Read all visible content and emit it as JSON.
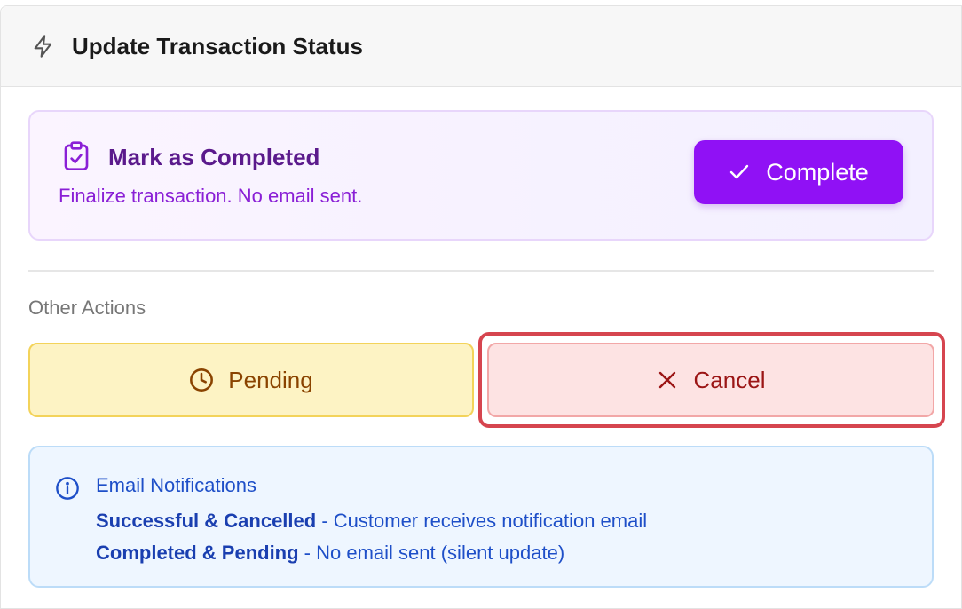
{
  "header": {
    "title": "Update Transaction Status",
    "icon": "bolt-icon"
  },
  "complete_box": {
    "title": "Mark as Completed",
    "description": "Finalize transaction. No email sent.",
    "button_label": "Complete",
    "icon": "clipboard-check-icon"
  },
  "other_actions": {
    "label": "Other Actions",
    "pending_label": "Pending",
    "cancel_label": "Cancel"
  },
  "info": {
    "title": "Email Notifications",
    "lines": [
      {
        "bold": "Successful & Cancelled",
        "text": " - Customer receives notification email"
      },
      {
        "bold": "Completed & Pending",
        "text": " - No email sent (silent update)"
      }
    ]
  },
  "colors": {
    "accent_purple": "#9011f5",
    "pending_bg": "#fdf3c4",
    "cancel_bg": "#fde3e3",
    "cancel_highlight": "#d6454f",
    "info_bg": "#eef6ff"
  }
}
